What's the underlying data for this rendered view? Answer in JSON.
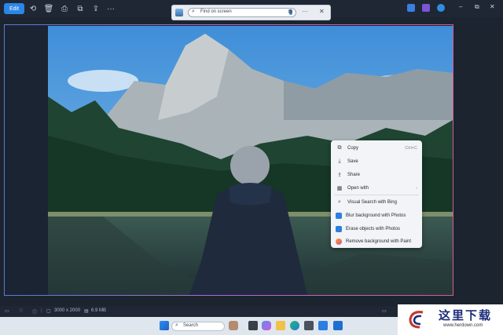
{
  "toolbar": {
    "edit_label": "Edit",
    "icons": [
      "rotate-icon",
      "delete-icon",
      "print-icon",
      "copy-icon",
      "export-icon",
      "more-icon"
    ]
  },
  "finder": {
    "placeholder": "Find on screen",
    "more": "···",
    "close": "✕"
  },
  "window_controls": {
    "minimize": "–",
    "maximize": "⧉",
    "close": "✕"
  },
  "context_menu": {
    "items": [
      {
        "label": "Copy",
        "shortcut": "Ctrl+C"
      },
      {
        "label": "Save"
      },
      {
        "label": "Share"
      },
      {
        "label": "Open with",
        "submenu": "›"
      },
      {
        "label": "Visual Search with Bing"
      },
      {
        "label": "Blur background with Photos"
      },
      {
        "label": "Erase objects with Photos"
      },
      {
        "label": "Remove background with Paint"
      }
    ]
  },
  "status": {
    "dimensions": "3000 x 2000",
    "size": "6.9 MB"
  },
  "taskbar": {
    "search_placeholder": "Search"
  },
  "watermark": {
    "chinese": "这里下载",
    "url": "www.herdown.com"
  }
}
